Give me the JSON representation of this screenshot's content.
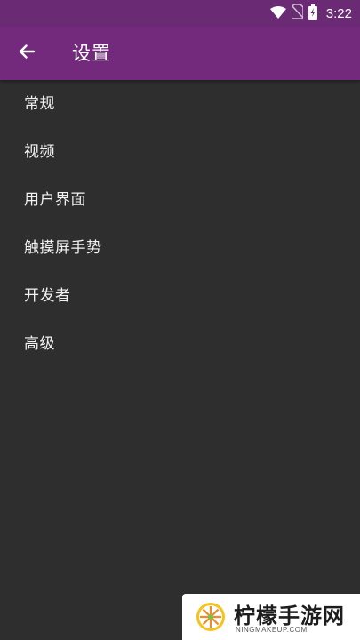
{
  "status_bar": {
    "time": "3:22",
    "icons": [
      "wifi-icon",
      "no-sim-icon",
      "battery-charging-icon"
    ]
  },
  "app_bar": {
    "title": "设置",
    "back_icon": "arrow-left-icon"
  },
  "menu": {
    "items": [
      {
        "label": "常规"
      },
      {
        "label": "视频"
      },
      {
        "label": "用户界面"
      },
      {
        "label": "触摸屏手势"
      },
      {
        "label": "开发者"
      },
      {
        "label": "高级"
      }
    ]
  },
  "watermark": {
    "brand": "柠檬手游网",
    "url": "NINGMAKEUP.COM"
  },
  "colors": {
    "status_bar": "#6a2a74",
    "app_bar": "#742a7c",
    "background": "#2e2e2e",
    "text": "#f2f2f2"
  }
}
